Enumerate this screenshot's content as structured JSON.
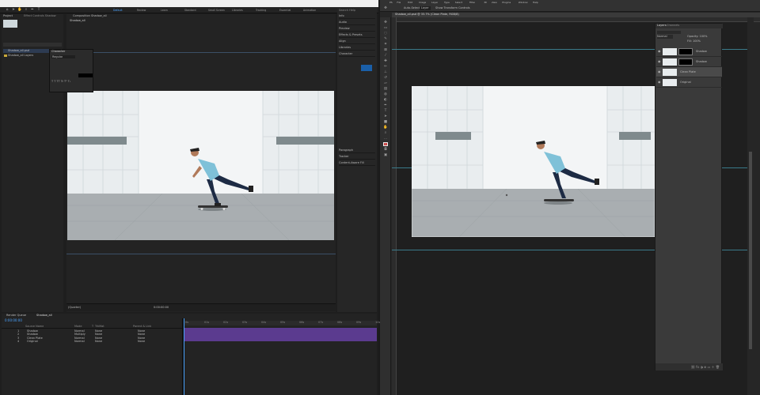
{
  "ae": {
    "workspaces": [
      "Default",
      "Review",
      "Learn",
      "Standard",
      "Small Screen",
      "Libraries",
      "Tracking",
      "Essential",
      "Animation"
    ],
    "active_workspace": "Default",
    "search_help": "Search Help",
    "project_tab": "Project",
    "effect_controls_tab": "Effect Controls Shadow",
    "comp_tab": "Composition Shadow_all",
    "comp_breadcrumb": "Shadow_all",
    "project_item": "Shadow_all.psd",
    "project_item_folder": "Shadow_all Layers",
    "right_panels": [
      "Info",
      "Audio",
      "Preview",
      "Effects & Presets",
      "Align",
      "Libraries",
      "Character",
      "Paragraph",
      "Tracker",
      "Content-Aware Fill"
    ],
    "character_popup_title": "Character",
    "character_font": "Regular",
    "viewer_zoom": "(Quarter)",
    "viewer_time": "0:00:00:00",
    "timeline_tabs": [
      "Render Queue",
      "Shadow_all"
    ],
    "timecode": "0:00:00:00",
    "timeline_columns": [
      "Source Name",
      "Mode",
      "T",
      "TrkMat",
      "Parent & Link"
    ],
    "layers": [
      {
        "num": "1",
        "name": "Shadow",
        "mode": "Normal",
        "trk": "None",
        "parent": "None"
      },
      {
        "num": "2",
        "name": "Shadow",
        "mode": "Multiply",
        "trk": "None",
        "parent": "None"
      },
      {
        "num": "3",
        "name": "Clean Plate",
        "mode": "Normal",
        "trk": "None",
        "parent": "None"
      },
      {
        "num": "4",
        "name": "Original",
        "mode": "Normal",
        "trk": "None",
        "parent": "None"
      }
    ],
    "ruler_ticks": [
      "0s",
      "01s",
      "02s",
      "03s",
      "04s",
      "05s",
      "06s",
      "07s",
      "08s",
      "09s",
      "10s"
    ]
  },
  "ps": {
    "menu": [
      "PS",
      "File",
      "Edit",
      "Image",
      "Layer",
      "Type",
      "Select",
      "Filter",
      "3D",
      "View",
      "Plugins",
      "Window",
      "Help"
    ],
    "doc_tab": "Shadow_all.psd @ 33.7% (Clean Plate, RGB/8)",
    "options_label": "Auto-Select",
    "options_value": "Layer",
    "options_transform": "Show Transform Controls",
    "layers_tab": "Layers",
    "channels_tab": "Channels",
    "blend_mode": "Normal",
    "opacity_label": "Opacity: 100%",
    "fill_label": "Fill: 100%",
    "layers": [
      {
        "name": "Shadow",
        "has_mask": true
      },
      {
        "name": "Shadow",
        "has_mask": true
      },
      {
        "name": "Clean Plate",
        "has_mask": false
      },
      {
        "name": "Original",
        "has_mask": false
      }
    ],
    "tools": [
      "move-icon",
      "marquee-icon",
      "lasso-icon",
      "quick-select-icon",
      "crop-icon",
      "frame-icon",
      "eyedropper-icon",
      "healing-icon",
      "brush-icon",
      "stamp-icon",
      "history-brush-icon",
      "eraser-icon",
      "gradient-icon",
      "blur-icon",
      "dodge-icon",
      "pen-icon",
      "type-icon",
      "path-select-icon",
      "shape-icon",
      "hand-icon",
      "zoom-icon",
      "more-icon",
      "foreground-color-icon",
      "quick-mask-icon",
      "screen-mode-icon"
    ]
  },
  "colors": {
    "ae_accent": "#4aa3ff",
    "timeline_bar": "#5b3b8f",
    "ps_fg_color": "#d23a3a",
    "guide": "#3a7a8a"
  }
}
